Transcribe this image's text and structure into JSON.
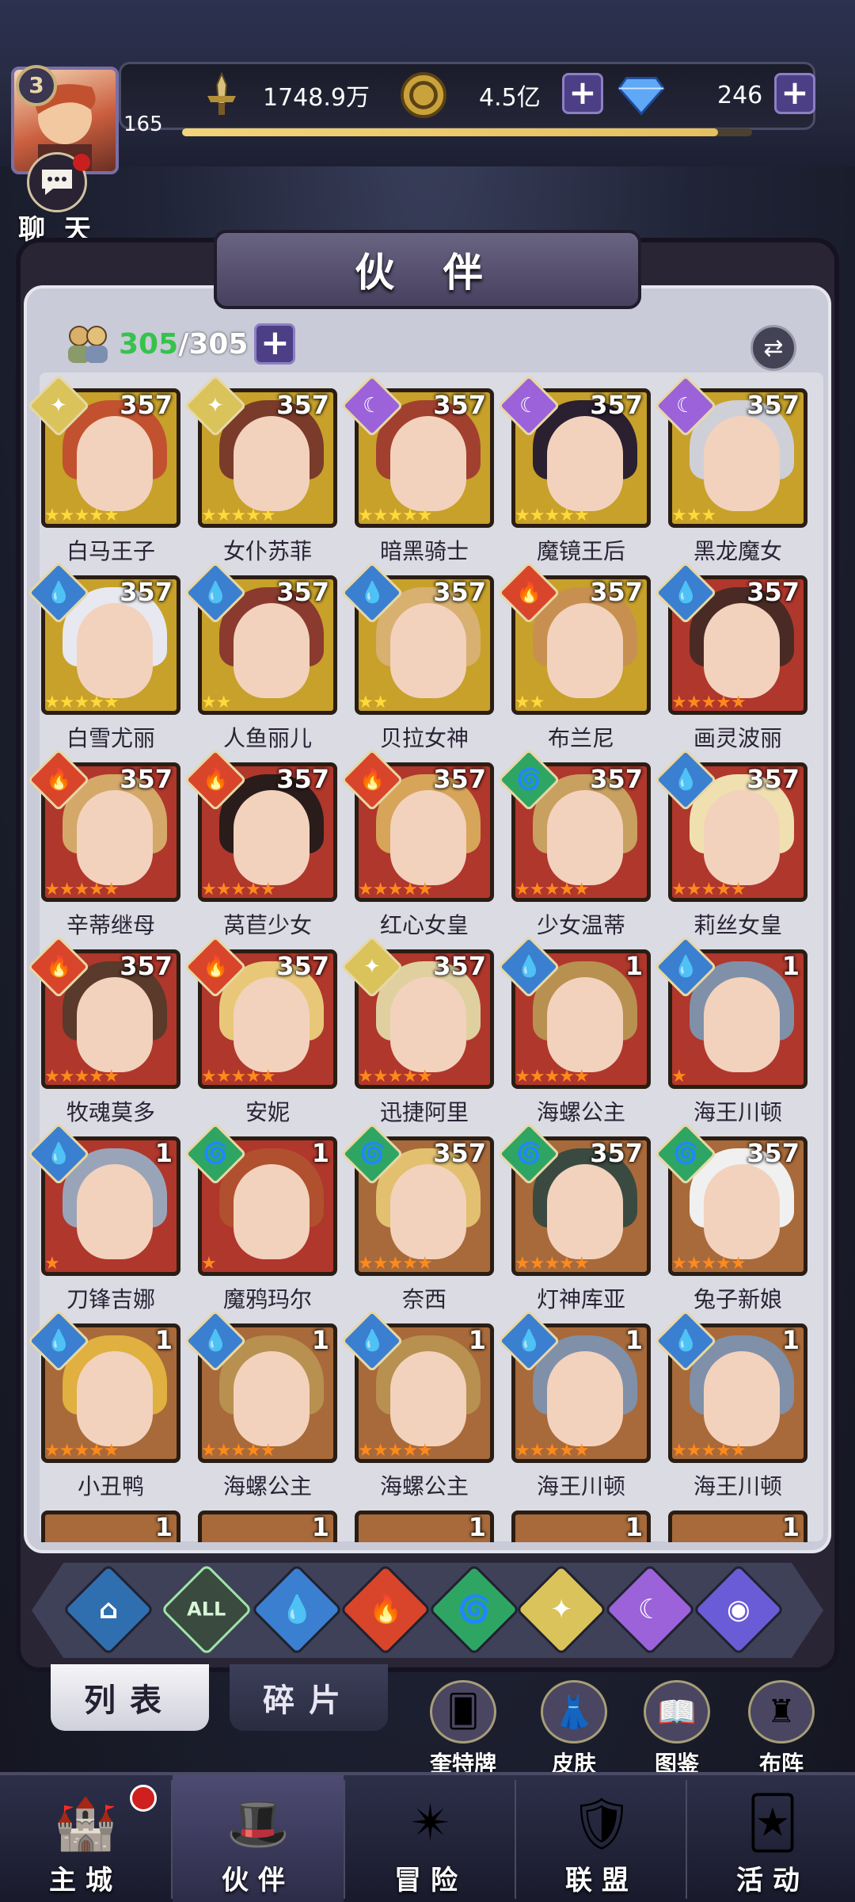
{
  "header": {
    "level": "3",
    "xp_value": "165",
    "power": "1748.9万",
    "gold": "4.5亿",
    "gems": "246",
    "chat_label": "聊 天"
  },
  "title": "伙 伴",
  "roster": {
    "owned": "305",
    "sep": "/",
    "max": "305"
  },
  "cards": [
    {
      "name": "白马王子",
      "level": "357",
      "element": "light",
      "frame": "gold",
      "stars": 5
    },
    {
      "name": "女仆苏菲",
      "level": "357",
      "element": "light",
      "frame": "gold",
      "stars": 5
    },
    {
      "name": "暗黑骑士",
      "level": "357",
      "element": "dark",
      "frame": "gold",
      "stars": 5
    },
    {
      "name": "魔镜王后",
      "level": "357",
      "element": "dark",
      "frame": "gold",
      "stars": 5
    },
    {
      "name": "黑龙魔女",
      "level": "357",
      "element": "dark",
      "frame": "gold",
      "stars": 3
    },
    {
      "name": "白雪尤丽",
      "level": "357",
      "element": "water",
      "frame": "gold",
      "stars": 5
    },
    {
      "name": "人鱼丽儿",
      "level": "357",
      "element": "water",
      "frame": "gold",
      "stars": 2
    },
    {
      "name": "贝拉女神",
      "level": "357",
      "element": "water",
      "frame": "gold",
      "stars": 2
    },
    {
      "name": "布兰尼",
      "level": "357",
      "element": "fire",
      "frame": "gold",
      "stars": 2
    },
    {
      "name": "画灵波丽",
      "level": "357",
      "element": "water",
      "frame": "red",
      "stars": 5
    },
    {
      "name": "辛蒂继母",
      "level": "357",
      "element": "fire",
      "frame": "red",
      "stars": 5
    },
    {
      "name": "莴苣少女",
      "level": "357",
      "element": "fire",
      "frame": "red",
      "stars": 5
    },
    {
      "name": "红心女皇",
      "level": "357",
      "element": "fire",
      "frame": "red",
      "stars": 5
    },
    {
      "name": "少女温蒂",
      "level": "357",
      "element": "wind",
      "frame": "red",
      "stars": 5
    },
    {
      "name": "莉丝女皇",
      "level": "357",
      "element": "water",
      "frame": "red",
      "stars": 5
    },
    {
      "name": "牧魂莫多",
      "level": "357",
      "element": "fire",
      "frame": "red",
      "stars": 5
    },
    {
      "name": "安妮",
      "level": "357",
      "element": "fire",
      "frame": "red",
      "stars": 5
    },
    {
      "name": "迅捷阿里",
      "level": "357",
      "element": "light",
      "frame": "red",
      "stars": 5
    },
    {
      "name": "海螺公主",
      "level": "1",
      "element": "water",
      "frame": "red",
      "stars": 5
    },
    {
      "name": "海王川顿",
      "level": "1",
      "element": "water",
      "frame": "red",
      "stars": 1
    },
    {
      "name": "刀锋吉娜",
      "level": "1",
      "element": "water",
      "frame": "red",
      "stars": 1
    },
    {
      "name": "魔鸦玛尔",
      "level": "1",
      "element": "wind",
      "frame": "red",
      "stars": 1
    },
    {
      "name": "奈西",
      "level": "357",
      "element": "wind",
      "frame": "brown",
      "stars": 5
    },
    {
      "name": "灯神库亚",
      "level": "357",
      "element": "wind",
      "frame": "brown",
      "stars": 5
    },
    {
      "name": "兔子新娘",
      "level": "357",
      "element": "wind",
      "frame": "brown",
      "stars": 5
    },
    {
      "name": "小丑鸭",
      "level": "1",
      "element": "water",
      "frame": "brown",
      "stars": 5
    },
    {
      "name": "海螺公主",
      "level": "1",
      "element": "water",
      "frame": "brown",
      "stars": 5
    },
    {
      "name": "海螺公主",
      "level": "1",
      "element": "water",
      "frame": "brown",
      "stars": 5
    },
    {
      "name": "海王川顿",
      "level": "1",
      "element": "water",
      "frame": "brown",
      "stars": 5
    },
    {
      "name": "海王川顿",
      "level": "1",
      "element": "water",
      "frame": "brown",
      "stars": 5
    }
  ],
  "partial_cards": [
    {
      "level": "1"
    },
    {
      "level": "1"
    },
    {
      "level": "1"
    },
    {
      "level": "1"
    },
    {
      "level": "1"
    }
  ],
  "filters": [
    "water-base",
    "ALL",
    "water",
    "fire",
    "wind",
    "light",
    "dark",
    "cosmic"
  ],
  "filter_all_label": "ALL",
  "subtabs": {
    "list": "列表",
    "fragments": "碎片"
  },
  "side_buttons": [
    "奎特牌",
    "皮肤",
    "图鉴",
    "布阵"
  ],
  "nav": [
    "主城",
    "伙伴",
    "冒险",
    "联盟",
    "活动"
  ],
  "colors": {
    "water": "#3b7fd0",
    "fire": "#d8452b",
    "wind": "#2fa563",
    "light": "#d9c35a",
    "dark": "#9b62d9",
    "cosmic": "#6a5bd6"
  }
}
